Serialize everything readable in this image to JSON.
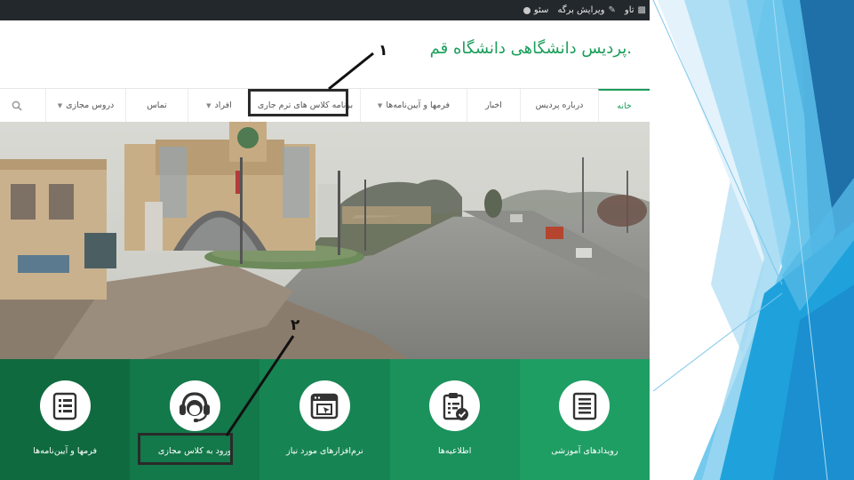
{
  "admin_bar": {
    "item_1": "تاو",
    "item_2": "ویرایش برگه",
    "item_3": "سئو"
  },
  "site": {
    "title": ".پردیس دانشگاهی دانشگاه قم"
  },
  "nav": {
    "items": [
      {
        "label": "خانه",
        "has_caret": false
      },
      {
        "label": "درباره پردیس",
        "has_caret": false
      },
      {
        "label": "اخبار",
        "has_caret": false
      },
      {
        "label": "فرمها و آیین‌نامه‌ها",
        "has_caret": true
      },
      {
        "label": "برنامه کلاس های ترم جاری",
        "has_caret": false
      },
      {
        "label": "افراد",
        "has_caret": true
      },
      {
        "label": "تماس",
        "has_caret": false
      },
      {
        "label": "دروس مجازی",
        "has_caret": true
      }
    ],
    "search_icon": "search-icon"
  },
  "hero": {
    "image": "campus-gate-photo"
  },
  "tiles": [
    {
      "label": "فرمها و آیین‌نامه‌ها",
      "icon": "document-list-icon",
      "color": "#0f6b3f"
    },
    {
      "label": "ورود به کلاس مجازی",
      "icon": "headset-support-icon",
      "color": "#13784a"
    },
    {
      "label": "نرم‌افزارهای مورد نیاز",
      "icon": "browser-window-icon",
      "color": "#178553"
    },
    {
      "label": "اطلاعیه‌ها",
      "icon": "clipboard-check-icon",
      "color": "#1b915c"
    },
    {
      "label": "رویدادهای آموزشی",
      "icon": "newspaper-icon",
      "color": "#1f9e64"
    }
  ],
  "annotations": {
    "marker_1": "۱",
    "marker_2": "۲"
  },
  "colors": {
    "brand_green": "#1a9e5a",
    "admin_bar": "#23282d",
    "slide_blue": "#1e8fc9"
  }
}
